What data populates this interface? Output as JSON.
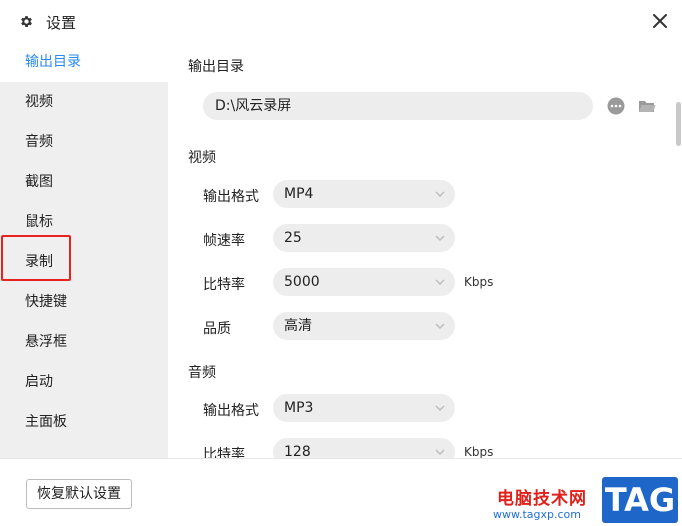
{
  "window": {
    "title": "设置"
  },
  "sidebar": {
    "items": [
      {
        "label": "输出目录",
        "active": true
      },
      {
        "label": "视频"
      },
      {
        "label": "音频"
      },
      {
        "label": "截图"
      },
      {
        "label": "鼠标"
      },
      {
        "label": "录制"
      },
      {
        "label": "快捷键"
      },
      {
        "label": "悬浮框"
      },
      {
        "label": "启动"
      },
      {
        "label": "主面板"
      }
    ]
  },
  "output_dir": {
    "title": "输出目录",
    "value": "D:\\风云录屏"
  },
  "video": {
    "title": "视频",
    "format_label": "输出格式",
    "format_value": "MP4",
    "fps_label": "帧速率",
    "fps_value": "25",
    "bitrate_label": "比特率",
    "bitrate_value": "5000",
    "bitrate_unit": "Kbps",
    "quality_label": "品质",
    "quality_value": "高清"
  },
  "audio": {
    "title": "音频",
    "format_label": "输出格式",
    "format_value": "MP3",
    "bitrate_label": "比特率",
    "bitrate_value": "128",
    "bitrate_unit": "Kbps"
  },
  "footer": {
    "reset_label": "恢复默认设置"
  },
  "watermark": {
    "text": "电脑技术网",
    "url": "www.tagxp.com",
    "tag": "TAG"
  },
  "colors": {
    "accent": "#2a8bf2",
    "highlight": "#e8231f",
    "sidebar_bg": "#efefef",
    "field_bg": "#ededed"
  }
}
